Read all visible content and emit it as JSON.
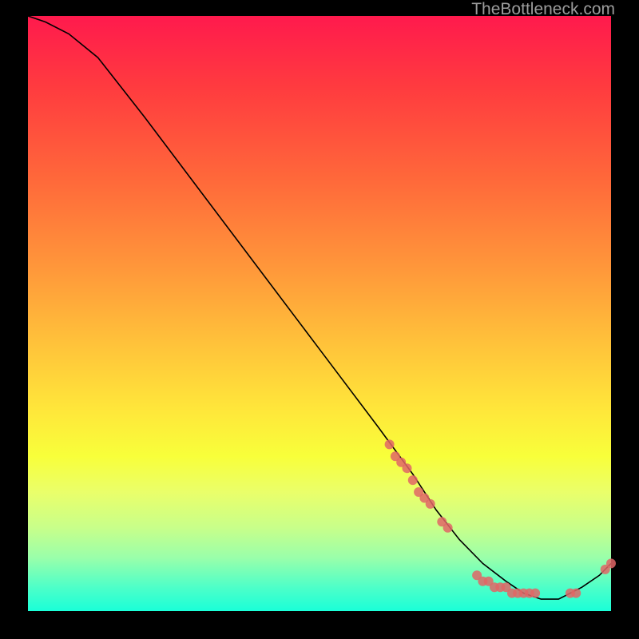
{
  "watermark": "TheBottleneck.com",
  "chart_data": {
    "type": "line",
    "title": "",
    "xlabel": "",
    "ylabel": "",
    "xlim": [
      0,
      100
    ],
    "ylim": [
      0,
      100
    ],
    "series": [
      {
        "name": "curve",
        "x": [
          0,
          3,
          7,
          12,
          20,
          30,
          40,
          50,
          60,
          66,
          70,
          74,
          78,
          82,
          85,
          88,
          91,
          95,
          98,
          100
        ],
        "y": [
          100,
          99,
          97,
          93,
          83,
          70,
          57,
          44,
          31,
          23,
          17,
          12,
          8,
          5,
          3,
          2,
          2,
          4,
          6,
          8
        ]
      }
    ],
    "markers": [
      {
        "x": 62,
        "y": 28
      },
      {
        "x": 63,
        "y": 26
      },
      {
        "x": 64,
        "y": 25
      },
      {
        "x": 65,
        "y": 24
      },
      {
        "x": 66,
        "y": 22
      },
      {
        "x": 67,
        "y": 20
      },
      {
        "x": 68,
        "y": 19
      },
      {
        "x": 69,
        "y": 18
      },
      {
        "x": 71,
        "y": 15
      },
      {
        "x": 72,
        "y": 14
      },
      {
        "x": 77,
        "y": 6
      },
      {
        "x": 78,
        "y": 5
      },
      {
        "x": 79,
        "y": 5
      },
      {
        "x": 80,
        "y": 4
      },
      {
        "x": 81,
        "y": 4
      },
      {
        "x": 82,
        "y": 4
      },
      {
        "x": 83,
        "y": 3
      },
      {
        "x": 84,
        "y": 3
      },
      {
        "x": 85,
        "y": 3
      },
      {
        "x": 86,
        "y": 3
      },
      {
        "x": 87,
        "y": 3
      },
      {
        "x": 93,
        "y": 3
      },
      {
        "x": 94,
        "y": 3
      },
      {
        "x": 99,
        "y": 7
      },
      {
        "x": 100,
        "y": 8
      }
    ]
  }
}
